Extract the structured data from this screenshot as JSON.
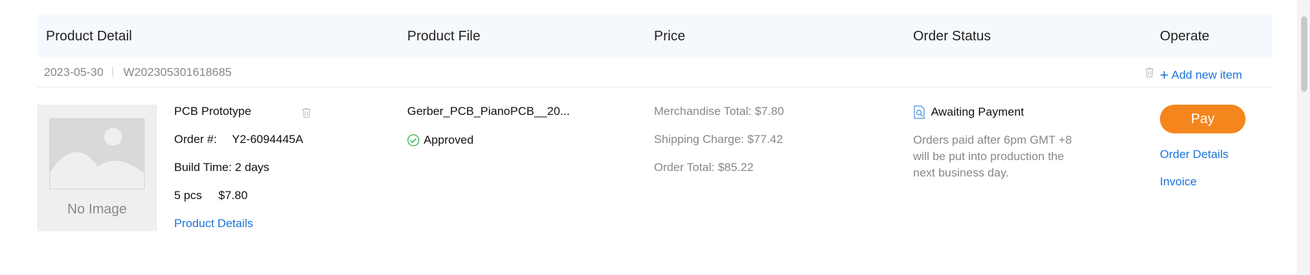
{
  "table": {
    "headers": {
      "product_detail": "Product Detail",
      "product_file": "Product File",
      "price": "Price",
      "order_status": "Order Status",
      "operate": "Operate"
    }
  },
  "order": {
    "date": "2023-05-30",
    "number": "W202305301618685",
    "add_item": "Add new item"
  },
  "item": {
    "image_placeholder": "No Image",
    "product_name": "PCB Prototype",
    "order_no_label": "Order #:",
    "order_no": "Y2-6094445A",
    "build_time": "Build Time: 2 days",
    "quantity": "5 pcs",
    "unit_price": "$7.80",
    "details_link": "Product Details",
    "file_name": "Gerber_PCB_PianoPCB__20...",
    "file_status": "Approved",
    "merchandise_total": "Merchandise Total: $7.80",
    "shipping_charge": "Shipping Charge: $77.42",
    "order_total": "Order Total: $85.22",
    "status": "Awaiting Payment",
    "status_note": "Orders paid after 6pm GMT +8 will be put into production the next business day.",
    "pay_label": "Pay",
    "order_details_link": "Order Details",
    "invoice_link": "Invoice"
  },
  "colors": {
    "accent_link": "#1a73d9",
    "pay_button": "#f5861e",
    "approved": "#2bb24c"
  },
  "icons": {
    "delete": "trash-icon",
    "status": "search-document-icon",
    "approved": "check-circle-icon"
  }
}
